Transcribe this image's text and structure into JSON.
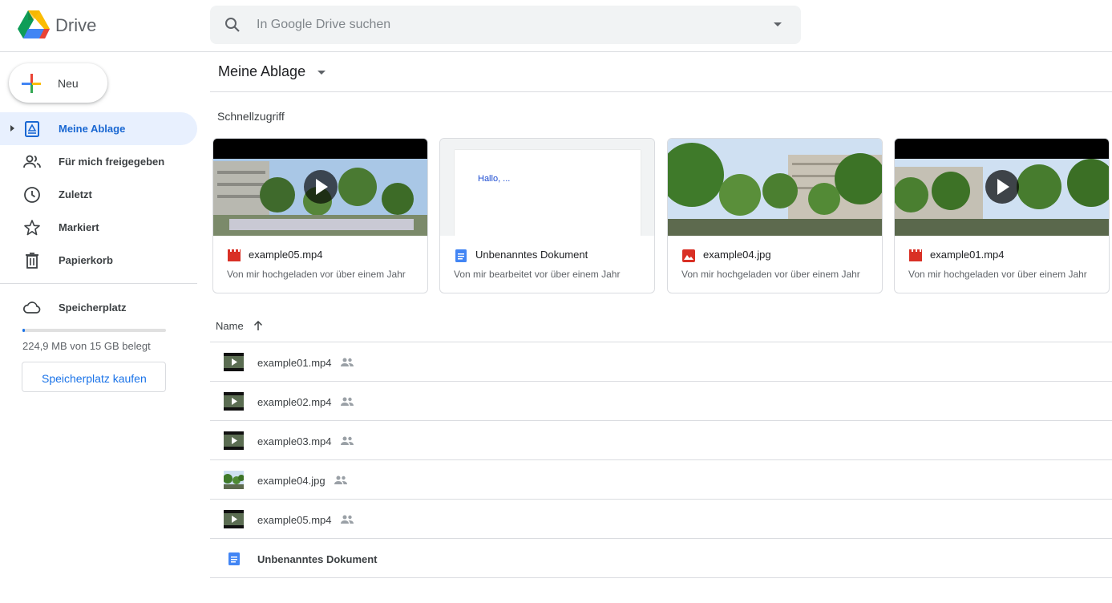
{
  "app": {
    "brand": "Drive"
  },
  "search": {
    "placeholder": "In Google Drive suchen"
  },
  "new_button": {
    "label": "Neu"
  },
  "sidebar": {
    "items": [
      {
        "label": "Meine Ablage",
        "icon": "my-drive-icon",
        "active": true
      },
      {
        "label": "Für mich freigegeben",
        "icon": "shared-people-icon",
        "active": false
      },
      {
        "label": "Zuletzt",
        "icon": "clock-icon",
        "active": false
      },
      {
        "label": "Markiert",
        "icon": "star-icon",
        "active": false
      },
      {
        "label": "Papierkorb",
        "icon": "trash-icon",
        "active": false
      }
    ],
    "storage": {
      "label": "Speicherplatz",
      "icon": "cloud-icon",
      "usage": "224,9 MB von 15 GB belegt",
      "used_fraction": 0.015,
      "buy_label": "Speicherplatz kaufen"
    }
  },
  "main": {
    "breadcrumb": "Meine Ablage",
    "quick_access": {
      "heading": "Schnellzugriff",
      "cards": [
        {
          "name": "example05.mp4",
          "subtitle": "Von mir hochgeladen vor über einem Jahr",
          "type": "video"
        },
        {
          "name": "Unbenanntes Dokument",
          "subtitle": "Von mir bearbeitet vor über einem Jahr",
          "type": "doc",
          "preview_text": "Hallo, ..."
        },
        {
          "name": "example04.jpg",
          "subtitle": "Von mir hochgeladen vor über einem Jahr",
          "type": "image"
        },
        {
          "name": "example01.mp4",
          "subtitle": "Von mir hochgeladen vor über einem Jahr",
          "type": "video"
        }
      ]
    },
    "list": {
      "column_name": "Name",
      "files": [
        {
          "name": "example01.mp4",
          "type": "video",
          "shared": true
        },
        {
          "name": "example02.mp4",
          "type": "video",
          "shared": true
        },
        {
          "name": "example03.mp4",
          "type": "video",
          "shared": true
        },
        {
          "name": "example04.jpg",
          "type": "image",
          "shared": true
        },
        {
          "name": "example05.mp4",
          "type": "video",
          "shared": true
        },
        {
          "name": "Unbenanntes Dokument",
          "type": "doc",
          "shared": false
        }
      ]
    }
  },
  "colors": {
    "accent": "#1a73e8",
    "active_bg": "#e8f0fe",
    "video_red": "#d93025",
    "doc_blue": "#4285f4"
  }
}
